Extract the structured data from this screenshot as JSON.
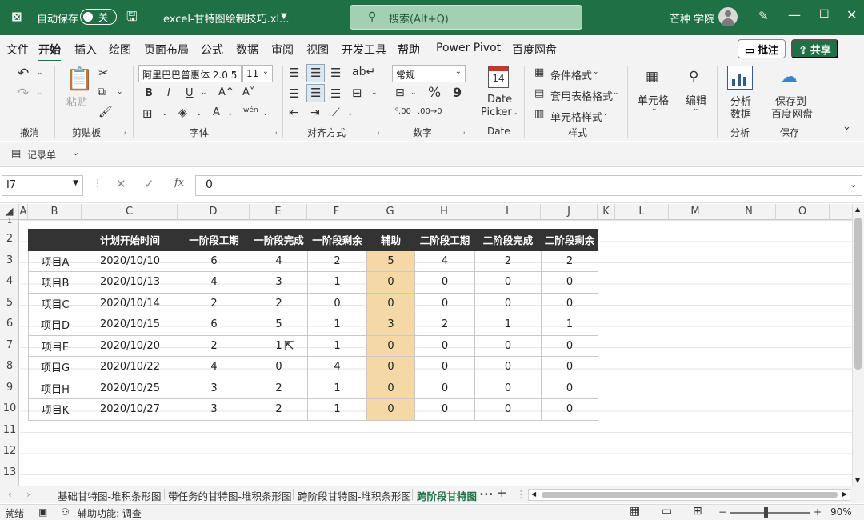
{
  "titlebar": {
    "autosave_label": "自动保存",
    "autosave_state": "关",
    "filename": "excel-甘特图绘制技巧.xl...",
    "search_placeholder": "搜索(Alt+Q)",
    "user": "芒种 学院"
  },
  "menu": {
    "items": [
      "文件",
      "开始",
      "插入",
      "绘图",
      "页面布局",
      "公式",
      "数据",
      "审阅",
      "视图",
      "开发工具",
      "帮助",
      "Power Pivot",
      "百度网盘"
    ],
    "active": "开始",
    "comment_button": "批注",
    "share_button": "共享"
  },
  "ribbon": {
    "groups": {
      "undo": "撤消",
      "clipboard": "剪贴板",
      "font": "字体",
      "alignment": "对齐方式",
      "number": "数字",
      "date": "Date",
      "styles": "样式",
      "analysis": "分析",
      "save": "保存"
    },
    "paste": "粘贴",
    "font_name": "阿里巴巴普惠体 2.0 5",
    "font_size": "11",
    "bold": "B",
    "italic": "I",
    "underline": "U",
    "grow_font": "A^",
    "shrink_font": "A˅",
    "number_format": "常规",
    "percent": "%",
    "comma": "9",
    "date_picker_line1": "Date",
    "date_picker_line2": "Picker",
    "calendar_day": "14",
    "conditional_format": "条件格式",
    "table_format": "套用表格格式",
    "cell_style": "单元格样式",
    "cells": "单元格",
    "editing": "编辑",
    "analyze_line1": "分析",
    "analyze_line2": "数据",
    "save_baidu_line1": "保存到",
    "save_baidu_line2": "百度网盘"
  },
  "quickaccess": {
    "form": "记录单"
  },
  "formulabar": {
    "cell_ref": "I7",
    "fx": "fx",
    "value": "0"
  },
  "columns": [
    "A",
    "B",
    "C",
    "D",
    "E",
    "F",
    "G",
    "H",
    "I",
    "J",
    "K",
    "L",
    "M",
    "N",
    "O"
  ],
  "rows": [
    "1",
    "2",
    "3",
    "4",
    "5",
    "6",
    "7",
    "8",
    "9",
    "10",
    "11",
    "12",
    "13"
  ],
  "table": {
    "headers": [
      "",
      "计划开始时间",
      "一阶段工期",
      "一阶段完成",
      "一阶段剩余",
      "辅助",
      "二阶段工期",
      "二阶段完成",
      "二阶段剩余"
    ],
    "rows": [
      [
        "项目A",
        "2020/10/10",
        "6",
        "4",
        "2",
        "5",
        "4",
        "2",
        "2"
      ],
      [
        "项目B",
        "2020/10/13",
        "4",
        "3",
        "1",
        "0",
        "0",
        "0",
        "0"
      ],
      [
        "项目C",
        "2020/10/14",
        "2",
        "2",
        "0",
        "0",
        "0",
        "0",
        "0"
      ],
      [
        "项目D",
        "2020/10/15",
        "6",
        "5",
        "1",
        "3",
        "2",
        "1",
        "1"
      ],
      [
        "项目E",
        "2020/10/20",
        "2",
        "1",
        "1",
        "0",
        "0",
        "0",
        "0"
      ],
      [
        "项目G",
        "2020/10/22",
        "4",
        "0",
        "4",
        "0",
        "0",
        "0",
        "0"
      ],
      [
        "项目H",
        "2020/10/25",
        "3",
        "2",
        "1",
        "0",
        "0",
        "0",
        "0"
      ],
      [
        "项目K",
        "2020/10/27",
        "3",
        "2",
        "1",
        "0",
        "0",
        "0",
        "0"
      ]
    ],
    "highlight_color": "#f4d9a6",
    "header_color": "#333333"
  },
  "sheets": {
    "tabs": [
      "基础甘特图-堆积条形图",
      "带任务的甘特图-堆积条形图",
      "跨阶段甘特图-堆积条形图",
      "跨阶段甘特图"
    ],
    "active": "跨阶段甘特图",
    "more": "•••",
    "add": "+"
  },
  "statusbar": {
    "ready": "就绪",
    "accessibility": "辅助功能: 调查",
    "zoom": "90%",
    "zoom_minus": "−",
    "zoom_plus": "+"
  },
  "colors": {
    "accent": "#1f7145"
  }
}
